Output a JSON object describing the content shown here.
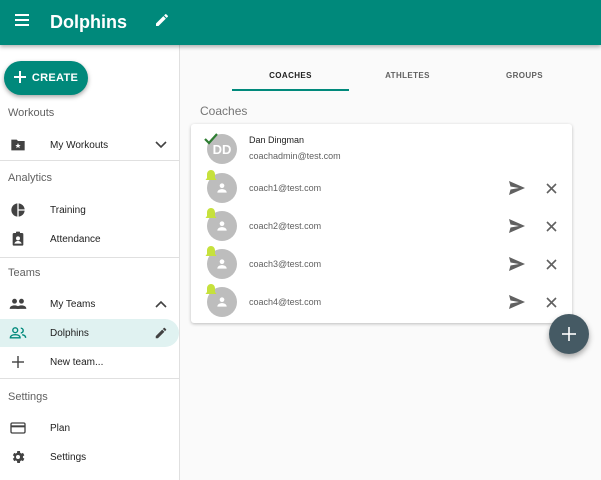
{
  "header": {
    "title": "Dolphins",
    "menu_icon": "menu-icon",
    "edit_icon": "pencil-icon"
  },
  "sidebar": {
    "create_label": "CREATE",
    "workouts": {
      "heading": "Workouts",
      "items": [
        {
          "label": "My Workouts",
          "icon": "starred-folder-icon"
        }
      ]
    },
    "analytics": {
      "heading": "Analytics",
      "items": [
        {
          "label": "Training",
          "icon": "pie-chart-icon"
        },
        {
          "label": "Attendance",
          "icon": "clipboard-person-icon"
        }
      ]
    },
    "teams": {
      "heading": "Teams",
      "items": [
        {
          "label": "My Teams",
          "icon": "people-icon"
        },
        {
          "label": "Dolphins",
          "icon": "team-icon"
        },
        {
          "label": "New team...",
          "icon": "plus-icon"
        }
      ]
    },
    "settings": {
      "heading": "Settings",
      "items": [
        {
          "label": "Plan",
          "icon": "credit-card-icon"
        },
        {
          "label": "Settings",
          "icon": "gear-icon"
        }
      ]
    }
  },
  "tabs": [
    {
      "label": "COACHES"
    },
    {
      "label": "ATHLETES"
    },
    {
      "label": "GROUPS"
    }
  ],
  "active_tab": "COACHES",
  "content": {
    "section_title": "Coaches",
    "coaches": [
      {
        "initials": "DD",
        "name": "Dan Dingman",
        "email": "coachadmin@test.com",
        "status": "accepted"
      },
      {
        "name": "",
        "email": "coach1@test.com",
        "status": "pending"
      },
      {
        "name": "",
        "email": "coach2@test.com",
        "status": "pending"
      },
      {
        "name": "",
        "email": "coach3@test.com",
        "status": "pending"
      },
      {
        "name": "",
        "email": "coach4@test.com",
        "status": "pending"
      }
    ]
  },
  "colors": {
    "primary": "#00897b",
    "fab": "#455a64",
    "active_bg": "#e0f2f1",
    "pending_badge": "#c6e13c",
    "accepted_check": "#2e7d32"
  }
}
